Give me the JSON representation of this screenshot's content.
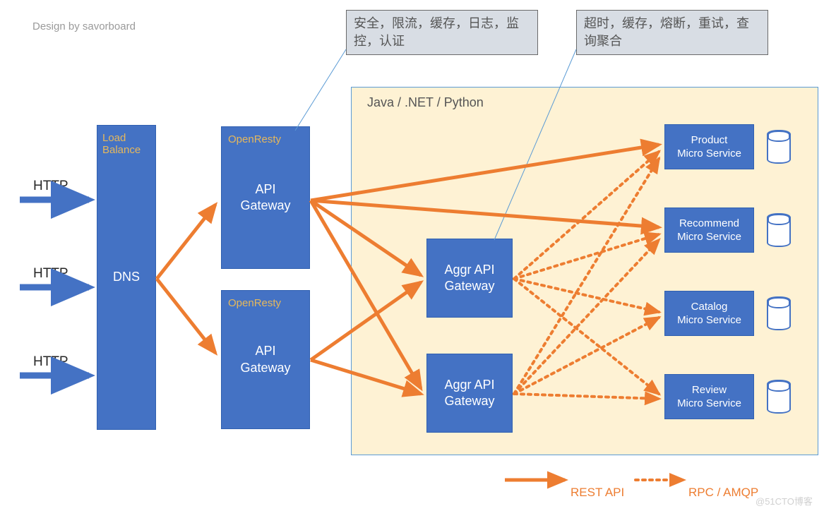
{
  "design_by": "Design by savorboard",
  "http_labels": [
    "HTTP",
    "HTTP",
    "HTTP"
  ],
  "dns": {
    "label": "Load\nBalance",
    "title": "DNS"
  },
  "gateways": {
    "label": "OpenResty",
    "title_line1": "API",
    "title_line2": "Gateway"
  },
  "annotations": {
    "gateway": "安全，限流，缓存，日志，监控，认证",
    "aggr": "超时，缓存，熔断，重试，查询聚合"
  },
  "container_title": "Java / .NET / Python",
  "aggr": {
    "line1": "Aggr API",
    "line2": "Gateway"
  },
  "services": [
    {
      "line1": "Product",
      "line2": "Micro Service"
    },
    {
      "line1": "Recommend",
      "line2": "Micro Service"
    },
    {
      "line1": "Catalog",
      "line2": "Micro Service"
    },
    {
      "line1": "Review",
      "line2": "Micro Service"
    }
  ],
  "legend": {
    "solid": "REST API",
    "dotted": "RPC / AMQP"
  },
  "watermark": "@51CTO博客"
}
